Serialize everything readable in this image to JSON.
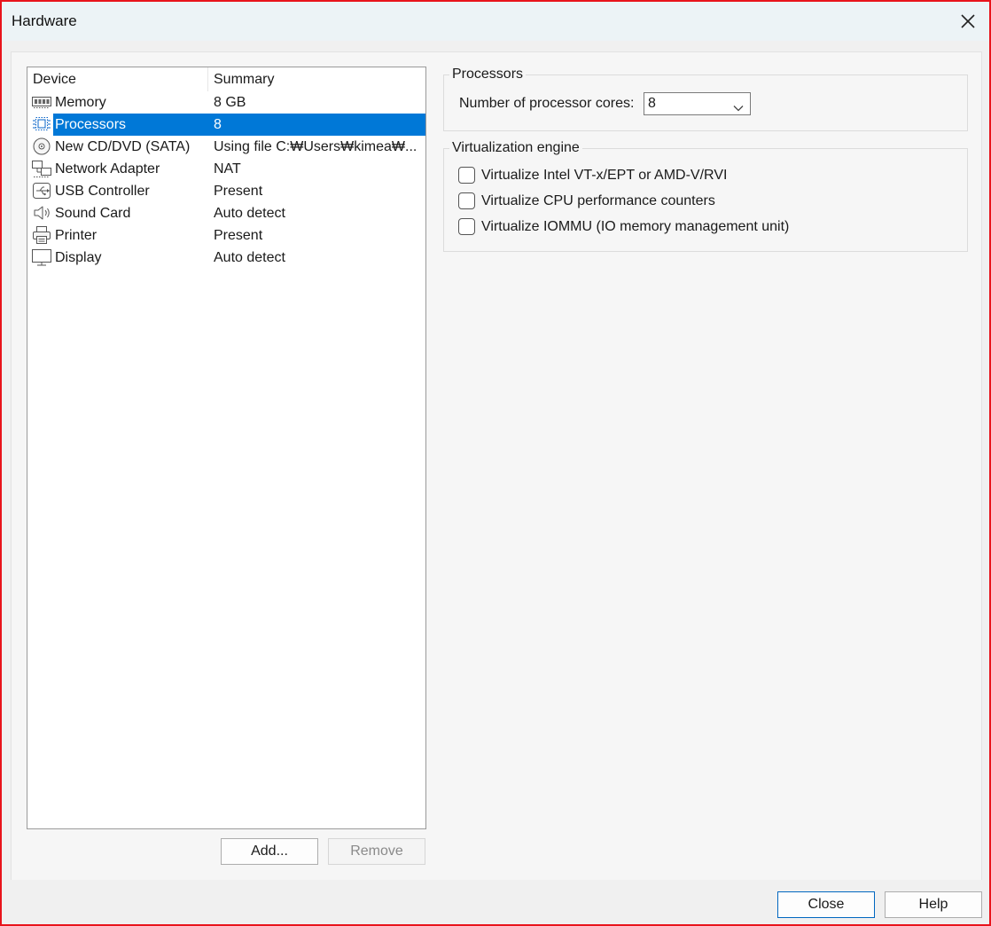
{
  "window": {
    "title": "Hardware"
  },
  "device_list": {
    "columns": {
      "device": "Device",
      "summary": "Summary"
    },
    "rows": [
      {
        "icon": "memory-icon",
        "device": "Memory",
        "summary": "8 GB",
        "selected": false
      },
      {
        "icon": "processor-icon",
        "device": "Processors",
        "summary": "8",
        "selected": true
      },
      {
        "icon": "cd-dvd-icon",
        "device": "New CD/DVD (SATA)",
        "summary": "Using file C:₩Users₩kimea₩...",
        "selected": false
      },
      {
        "icon": "network-icon",
        "device": "Network Adapter",
        "summary": "NAT",
        "selected": false
      },
      {
        "icon": "usb-icon",
        "device": "USB Controller",
        "summary": "Present",
        "selected": false
      },
      {
        "icon": "sound-icon",
        "device": "Sound Card",
        "summary": "Auto detect",
        "selected": false
      },
      {
        "icon": "printer-icon",
        "device": "Printer",
        "summary": "Present",
        "selected": false
      },
      {
        "icon": "display-icon",
        "device": "Display",
        "summary": "Auto detect",
        "selected": false
      }
    ],
    "add_label": "Add...",
    "remove_label": "Remove"
  },
  "processors": {
    "group_title": "Processors",
    "cores_label": "Number of processor cores:",
    "cores_value": "8"
  },
  "virtualization": {
    "group_title": "Virtualization engine",
    "options": [
      {
        "label": "Virtualize Intel VT-x/EPT or AMD-V/RVI",
        "checked": false
      },
      {
        "label": "Virtualize CPU performance counters",
        "checked": false
      },
      {
        "label": "Virtualize IOMMU (IO memory management unit)",
        "checked": false
      }
    ]
  },
  "footer": {
    "close_label": "Close",
    "help_label": "Help"
  },
  "colors": {
    "selection": "#0078d7",
    "border_accent": "#e8141c",
    "default_button": "#0067c0"
  }
}
